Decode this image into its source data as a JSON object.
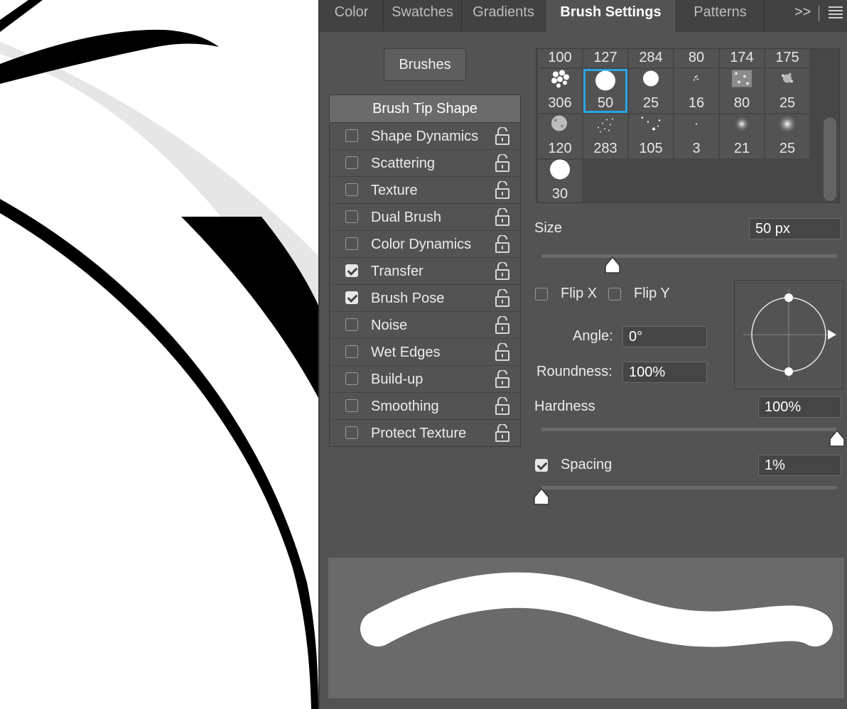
{
  "tabs": [
    {
      "label": "Color",
      "active": false
    },
    {
      "label": "Swatches",
      "active": false
    },
    {
      "label": "Gradients",
      "active": false
    },
    {
      "label": "Brush Settings",
      "active": true
    },
    {
      "label": "Patterns",
      "active": false
    }
  ],
  "tab_overflow": ">>",
  "brushes_button": "Brushes",
  "brush_tip_shape": "Brush Tip Shape",
  "options": [
    {
      "label": "Shape Dynamics",
      "checked": false
    },
    {
      "label": "Scattering",
      "checked": false
    },
    {
      "label": "Texture",
      "checked": false
    },
    {
      "label": "Dual Brush",
      "checked": false
    },
    {
      "label": "Color Dynamics",
      "checked": false
    },
    {
      "label": "Transfer",
      "checked": true
    },
    {
      "label": "Brush Pose",
      "checked": true
    },
    {
      "label": "Noise",
      "checked": false
    },
    {
      "label": "Wet Edges",
      "checked": false
    },
    {
      "label": "Build-up",
      "checked": false
    },
    {
      "label": "Smoothing",
      "checked": false
    },
    {
      "label": "Protect Texture",
      "checked": false
    }
  ],
  "presets": {
    "top_row": [
      "100",
      "127",
      "284",
      "80",
      "174",
      "175"
    ],
    "row2": [
      "306",
      "50",
      "25",
      "16",
      "80",
      "25"
    ],
    "row3": [
      "120",
      "283",
      "105",
      "3",
      "21",
      "25"
    ],
    "row4": [
      "30"
    ],
    "selected": "50"
  },
  "size": {
    "label": "Size",
    "value": "50 px",
    "fraction": 0.24
  },
  "flip_x": {
    "label": "Flip X",
    "checked": false
  },
  "flip_y": {
    "label": "Flip Y",
    "checked": false
  },
  "angle": {
    "label": "Angle:",
    "value": "0°"
  },
  "roundness": {
    "label": "Roundness:",
    "value": "100%"
  },
  "hardness": {
    "label": "Hardness",
    "value": "100%",
    "fraction": 1.0
  },
  "spacing": {
    "label": "Spacing",
    "value": "1%",
    "checked": true,
    "fraction": 0.0
  },
  "colors": {
    "panel": "#535353",
    "tabbar": "#424242",
    "selection": "#27a6e5",
    "preview": "#6a6a6a"
  }
}
